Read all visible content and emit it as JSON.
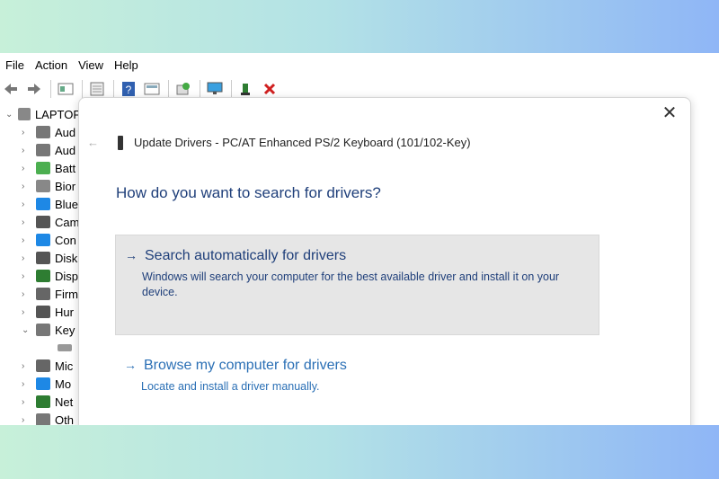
{
  "menu": [
    "File",
    "Action",
    "View",
    "Help"
  ],
  "toolbar": [
    "back-arrow-icon",
    "forward-arrow-icon",
    "properties-icon",
    "update-driver-icon",
    "help-icon",
    "view-icon",
    "scan-icon",
    "monitor-icon",
    "enable-device-icon",
    "uninstall-icon"
  ],
  "tree": {
    "root": "LAPTOP",
    "items": [
      "Aud",
      "Aud",
      "Batt",
      "Bior",
      "Blue",
      "Cam",
      "Con",
      "Disk",
      "Disp",
      "Firm",
      "Hur",
      "Key",
      "",
      "Mic",
      "Mo",
      "Net",
      "Oth"
    ],
    "colors": [
      "#777777",
      "#777777",
      "#4caf50",
      "#888888",
      "#1e88e5",
      "#555555",
      "#1e88e5",
      "#555555",
      "#2e7d32",
      "#666666",
      "#555555",
      "#777777",
      "#999999",
      "#666666",
      "#1e88e5",
      "#2e7d32",
      "#777777"
    ]
  },
  "dialog": {
    "title": "Update Drivers - PC/AT Enhanced PS/2 Keyboard (101/102-Key)",
    "question": "How do you want to search for drivers?",
    "option1": {
      "arrow": "→",
      "title": "Search automatically for drivers",
      "desc": "Windows will search your computer for the best available driver and install it on your device."
    },
    "option2": {
      "arrow": "→",
      "title": "Browse my computer for drivers",
      "desc": "Locate and install a driver manually."
    },
    "close": "✕",
    "back": "←"
  },
  "colors": {
    "accent": "#1f3f7a",
    "link": "#2a6fb5",
    "selected_bg": "#e6e6e6"
  }
}
